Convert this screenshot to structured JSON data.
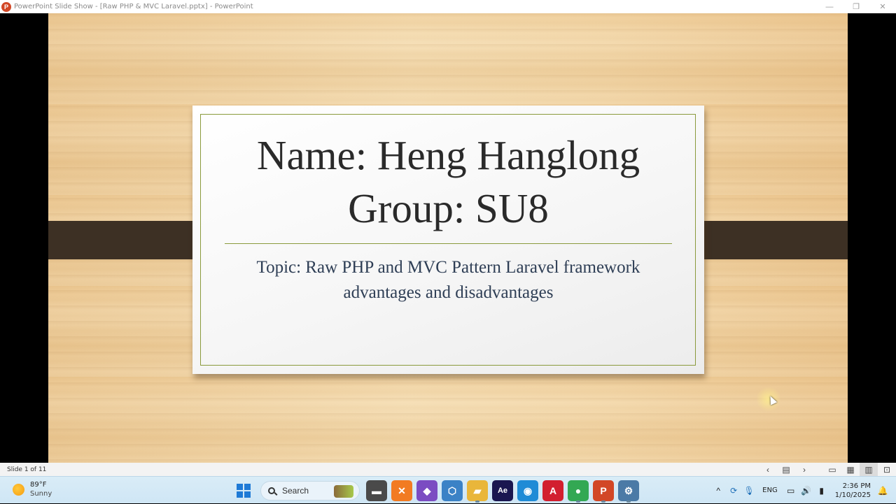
{
  "window": {
    "title": "PowerPoint Slide Show - [Raw PHP & MVC Laravel.pptx] - PowerPoint",
    "app_icon": "P",
    "controls": [
      "minimize-icon",
      "restore-icon",
      "close-icon"
    ]
  },
  "slide": {
    "title_line1": "Name: Heng Hanglong",
    "title_line2": "Group: SU8",
    "topic_line1": "Topic: Raw PHP and MVC Pattern Laravel framework",
    "topic_line2": "advantages and disadvantages",
    "colors": {
      "frame": "#8a9a3c",
      "strap": "#3d3024",
      "topic_text": "#2e3e55"
    }
  },
  "statusbar": {
    "slide_indicator": "Slide 1 of 11",
    "buttons": [
      "previous-icon",
      "slide-menu-icon",
      "next-icon",
      "normal-view-icon",
      "slide-sorter-icon",
      "reading-view-icon",
      "slide-show-icon"
    ]
  },
  "taskbar": {
    "weather": {
      "temp": "89°F",
      "condition": "Sunny",
      "icon": "sun-icon"
    },
    "search_label": "Search",
    "apps": [
      {
        "name": "file-explorer-icon",
        "glyph": "▬",
        "color": "#4a4a4a"
      },
      {
        "name": "xampp-icon",
        "glyph": "✕",
        "color": "#f27b22"
      },
      {
        "name": "visual-studio-icon",
        "glyph": "◆",
        "color": "#7b4cc2"
      },
      {
        "name": "3d-app-icon",
        "glyph": "⬡",
        "color": "#3b82c6"
      },
      {
        "name": "folder-icon",
        "glyph": "▰",
        "color": "#e9b63a"
      },
      {
        "name": "after-effects-icon",
        "glyph": "Ae",
        "color": "#1a1650"
      },
      {
        "name": "edge-icon",
        "glyph": "◉",
        "color": "#1f8bd6"
      },
      {
        "name": "autocad-icon",
        "glyph": "A",
        "color": "#d21f2f"
      },
      {
        "name": "chrome-icon",
        "glyph": "●",
        "color": "#33a853"
      },
      {
        "name": "powerpoint-icon",
        "glyph": "P",
        "color": "#d24726"
      },
      {
        "name": "settings-icon",
        "glyph": "⚙",
        "color": "#4b7aa6"
      }
    ],
    "language": "ENG",
    "time": "2:36 PM",
    "date": "1/10/2025"
  }
}
